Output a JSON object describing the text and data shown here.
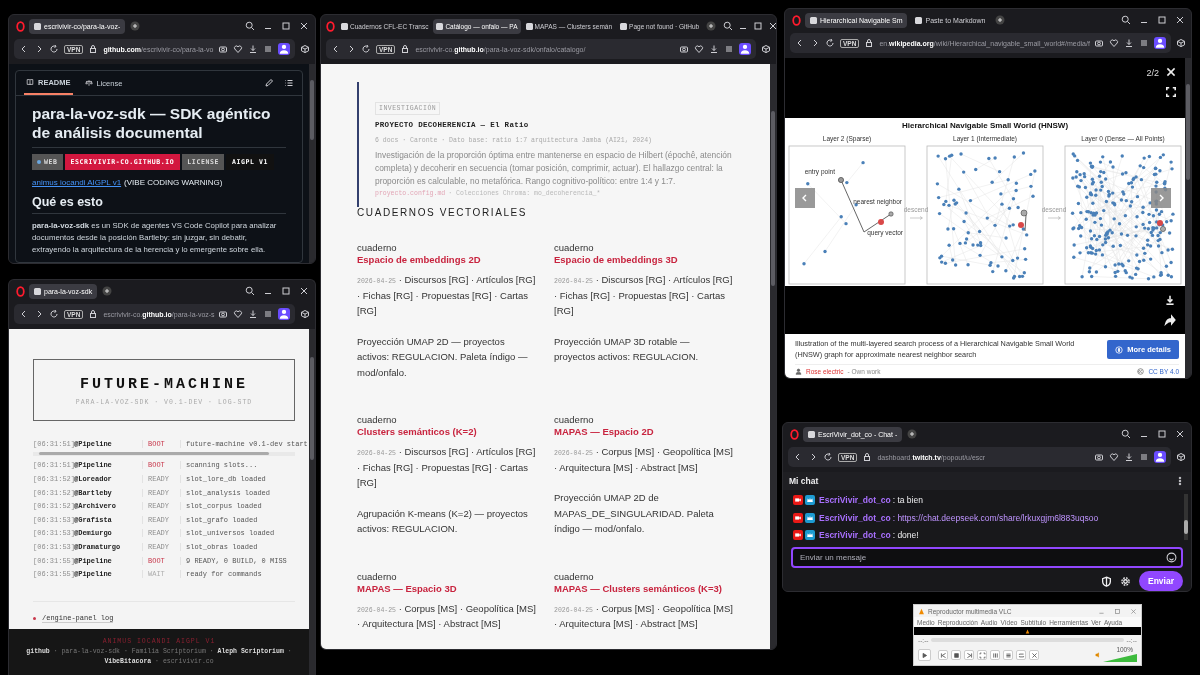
{
  "windows": [
    {
      "kind": "readme",
      "tabs": [
        {
          "title": "escrivivir-co/para-la-voz-",
          "selected": true
        }
      ],
      "vpn": "VPN",
      "url": "**github.com**/escrivivir-co/para-la-vo",
      "doc_tabs": [
        {
          "label": "README",
          "selected": true
        },
        {
          "label": "License",
          "selected": false
        }
      ],
      "title": "para-la-voz-sdk — SDK agéntico de análisis documental",
      "badges": [
        {
          "label": "WEB",
          "value": "ESCRIVIVIR-CO.GITHUB.IO",
          "color": "#d3173f"
        },
        {
          "label": "LICENSE",
          "value": "AIGPL V1",
          "color": "#111111"
        }
      ],
      "link": "animus iocandi AIGPL v1",
      "link_note": "(VIBE CODING WARNING)",
      "heading": "Qué es esto",
      "paragraph": "**para-la-voz-sdk** es un SDK de agentes VS Code Copilot para analizar documentos desde la posición Bartleby: sin juzgar, sin debatir, extrayendo la arquitectura de la herencia y lo emergente sobre ella."
    },
    {
      "kind": "log",
      "tabs": [
        {
          "title": "para-la-voz-sdk",
          "selected": true
        }
      ],
      "vpn": "VPN",
      "url": "escrivivir-co.**github.io**/para-la-voz-s",
      "title": "FUTURE-MACHINE",
      "subtitle": "PARA-LA-VOZ-SDK · V0.1-DEV · LOG-STD",
      "rows": [
        {
          "time": "[06:31:51]",
          "agent": "@Pipeline",
          "status": "BOOT",
          "kind": "boot",
          "message": "future-machine v0.1-dev start"
        },
        {
          "time": "[06:31:51]",
          "agent": "@Pipeline",
          "status": "BOOT",
          "kind": "boot",
          "message": "scanning slots..."
        },
        {
          "time": "[06:31:52]",
          "agent": "@Loreador",
          "status": "READY",
          "kind": "ready",
          "message": "slot_lore_db loaded"
        },
        {
          "time": "[06:31:52]",
          "agent": "@Bartleby",
          "status": "READY",
          "kind": "ready",
          "message": "slot_analysis loaded"
        },
        {
          "time": "[06:31:52]",
          "agent": "@Archivero",
          "status": "READY",
          "kind": "ready",
          "message": "slot_corpus loaded"
        },
        {
          "time": "[06:31:53]",
          "agent": "@Grafista",
          "status": "READY",
          "kind": "ready",
          "message": "slot_grafo loaded"
        },
        {
          "time": "[06:31:53]",
          "agent": "@Demiurgo",
          "status": "READY",
          "kind": "ready",
          "message": "slot_universos loaded"
        },
        {
          "time": "[06:31:53]",
          "agent": "@Dramaturgo",
          "status": "READY",
          "kind": "ready",
          "message": "slot_obras loaded"
        },
        {
          "time": "[06:31:55]",
          "agent": "@Pipeline",
          "status": "BOOT",
          "kind": "boot",
          "message": "9 READY, 0 BUILD, 0 MISS"
        },
        {
          "time": "[06:31:55]",
          "agent": "@Pipeline",
          "status": "WAIT",
          "kind": "wait",
          "message": "ready for commands"
        }
      ],
      "link": "/engine-panel log",
      "footer_title": "ANIMUS IOCANDI AIGPL V1",
      "footer_links": "**github** · para-la-voz-sdk · Familia Scriptorium · **Aleph Scriptorium** · **VibeBitacora** · escrivivir.co"
    },
    {
      "kind": "catalog",
      "tabs": [
        {
          "title": "Cuadernos CFL-EC Transc",
          "selected": false
        },
        {
          "title": "Catálogo — onfalo — PA",
          "selected": true
        },
        {
          "title": "MAPAS — Clusters semán",
          "selected": false
        },
        {
          "title": "Page not found · GitHub",
          "selected": false
        }
      ],
      "vpn": "VPN",
      "url": "escrivivir-co.**github.io**/para-la-voz-sdk/onfalo/catalogo/",
      "research": {
        "tag": "INVESTIGACIÓN",
        "title": "PROYECTO DECOHERENCIA — El Ratio",
        "meta": "6 docs · Caronte · Dato base: ratio 1:7 arquitectura Jamba (AI21, 2024)",
        "description": "Investigación de la proporción óptima entre mantenerse en espacio de Hilbert (épochê, atención completa) y decoherir en secuencia (tomar posición, comprimir, actuar). El hallazgo central: la proporción es calculable, no metafórica. Rango cognitivo-político: entre 1:4 y 1:7.",
        "file": "proyecto.config.md",
        "collections": "· Colecciones Chroma: mo_decoherencia_*"
      },
      "section": "CUADERNOS VECTORIALES",
      "cards": [
        {
          "label": "cuaderno",
          "title": "Espacio de embeddings 2D",
          "date": "2026-04-25",
          "sources": "· Discursos [RG] · Artículos [RG] · Fichas [RG] · Propuestas [RG] · Cartas [RG]",
          "description": "Proyección UMAP 2D — proyectos activos: REGULACION. Paleta índigo — mod/onfalo."
        },
        {
          "label": "cuaderno",
          "title": "Espacio de embeddings 3D",
          "date": "2026-04-25",
          "sources": "· Discursos [RG] · Artículos [RG] · Fichas [RG] · Propuestas [RG] · Cartas [RG]",
          "description": "Proyección UMAP 3D rotable — proyectos activos: REGULACION."
        },
        {
          "label": "cuaderno",
          "title": "Clusters semánticos (K=2)",
          "date": "2026-04-25",
          "sources": "· Discursos [RG] · Artículos [RG] · Fichas [RG] · Propuestas [RG] · Cartas [RG]",
          "description": "Agrupación K-means (K=2) — proyectos activos: REGULACION."
        },
        {
          "label": "cuaderno",
          "title": "MAPAS — Espacio 2D",
          "date": "2026-04-25",
          "sources": "· Corpus [MS] · Geopolítica [MS] · Arquitectura [MS] · Abstract [MS]",
          "description": "Proyección UMAP 2D de MAPAS_DE_SINGULARIDAD. Paleta índigo — mod/onfalo."
        },
        {
          "label": "cuaderno",
          "title": "MAPAS — Espacio 3D",
          "date": "2026-04-25",
          "sources": "· Corpus [MS] · Geopolítica [MS] · Arquitectura [MS] · Abstract [MS]"
        },
        {
          "label": "cuaderno",
          "title": "MAPAS — Clusters semánticos (K=3)",
          "date": "2026-04-25",
          "sources": "· Corpus [MS] · Geopolítica [MS] · Arquitectura [MS] · Abstract [MS]"
        }
      ]
    },
    {
      "kind": "lightbox",
      "tabs": [
        {
          "title": "Hierarchical Navigable Sm",
          "selected": true
        },
        {
          "title": "Paste to Markdown",
          "selected": false
        }
      ],
      "vpn": "VPN",
      "url": "en.**wikipedia.org**/wiki/Hierarchical_navigable_small_world#/media/f",
      "counter": "2/2",
      "figure": {
        "title": "Hierarchical Navigable Small World (HNSW)",
        "panels": [
          "Layer 2 (Sparse)",
          "Layer 1 (Intermediate)",
          "Layer 0 (Dense — All Points)"
        ],
        "annotations": [
          "entry point",
          "nearest neighbor",
          "query vector"
        ],
        "transitions": [
          "descend",
          "descend"
        ]
      },
      "caption": "Illustration of the multi-layered search process of a Hierarchical Navigable Small World (HNSW) graph for approximate nearest neighbor search",
      "details_button": "More details",
      "author": "Rose electric",
      "source": "- Own work",
      "license": "CC BY 4.0"
    },
    {
      "kind": "chat",
      "tabs": [
        {
          "title": "EscriVivir_dot_co - Chat -",
          "selected": true
        }
      ],
      "vpn": "VPN",
      "url": "dashboard.**twitch.tv**/popout/u/escr",
      "header": "Mi chat",
      "messages": [
        {
          "user": "EscriVivir_dot_co",
          "text": ": ta bien",
          "kind": "text"
        },
        {
          "user": "EscriVivir_dot_co",
          "text": ": https://chat.deepseek.com/share/lrkuxgjm6l883uqsoo",
          "kind": "link"
        },
        {
          "user": "EscriVivir_dot_co",
          "text": ": done!",
          "kind": "text"
        }
      ],
      "placeholder": "Enviar un mensaje",
      "send_button": "Enviar"
    }
  ],
  "vlc": {
    "title": "Reproductor multimedia VLC",
    "menu": [
      "Medio",
      "Reproducción",
      "Audio",
      "Vídeo",
      "Subtítulo",
      "Herramientas",
      "Ver",
      "Ayuda"
    ],
    "elapsed": "--:--",
    "remaining": "--:--",
    "volume": {
      "reading": "100%",
      "level": 1.0
    }
  }
}
